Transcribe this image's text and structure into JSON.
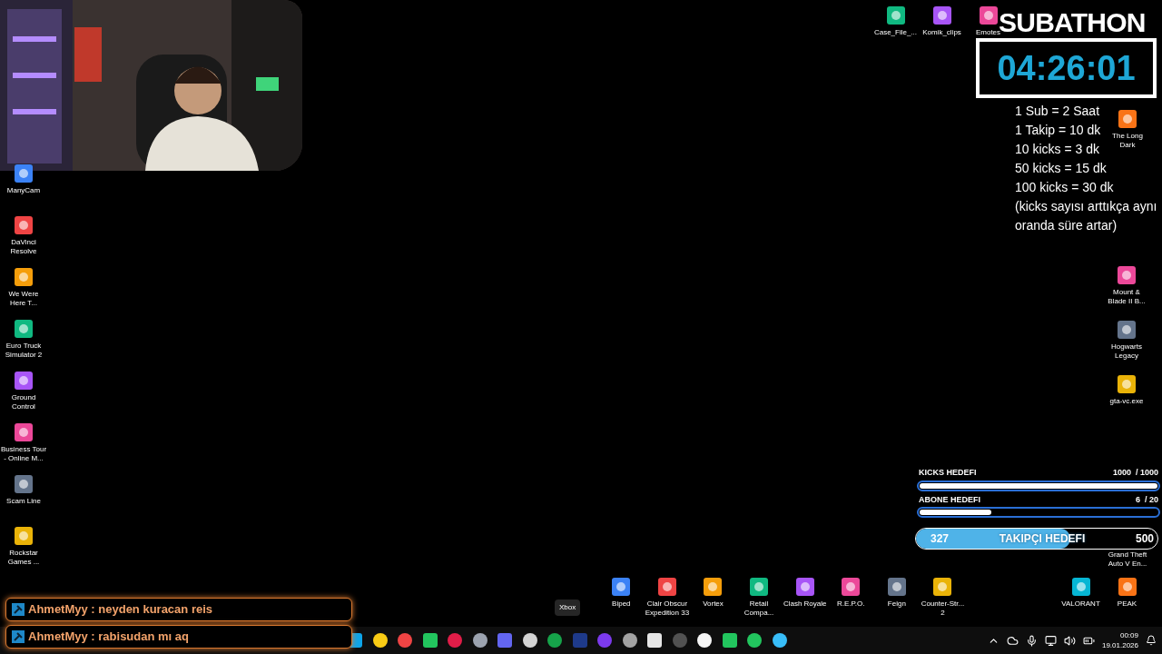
{
  "desktop_left": [
    {
      "label": "ManyCam"
    },
    {
      "label": "DaVinci Resolve"
    },
    {
      "label": "We Were Here T..."
    },
    {
      "label": "Euro Truck Simulator 2"
    },
    {
      "label": "Ground Control"
    },
    {
      "label": "Business Tour - Online M..."
    },
    {
      "label": "Scam Line"
    },
    {
      "label": "Rockstar Games ..."
    }
  ],
  "desktop_top": [
    {
      "label": "Case_File_..."
    },
    {
      "label": "Komik_clips"
    },
    {
      "label": "Emotes"
    }
  ],
  "desktop_right": [
    {
      "label": "The Long Dark"
    },
    {
      "label": "Mount & Blade II B..."
    },
    {
      "label": "Hogwarts Legacy"
    },
    {
      "label": "gta-vc.exe"
    }
  ],
  "desktop_bottom": [
    {
      "label": "Biped"
    },
    {
      "label": "Clair Obscur Expedition 33"
    },
    {
      "label": "Vortex"
    },
    {
      "label": "Retail Compa..."
    },
    {
      "label": "Clash Royale"
    },
    {
      "label": "R.E.P.O."
    },
    {
      "label": "Feign"
    },
    {
      "label": "Counter-Str... 2"
    }
  ],
  "desktop_bottom_right": [
    {
      "label": "VALORANT"
    },
    {
      "label": "PEAK"
    }
  ],
  "subathon": {
    "title": "SUBATHON",
    "timer": "04:26:01",
    "rules": [
      "1 Sub = 2 Saat",
      "1 Takip = 10 dk",
      "10 kicks = 3 dk",
      "50 kicks = 15 dk",
      "100 kicks = 30 dk",
      "(kicks sayısı arttıkça aynı oranda süre artar)"
    ]
  },
  "goals": [
    {
      "label": "KICKS HEDEFI",
      "reading": "1000  / 1000",
      "level": 1
    },
    {
      "label": "ABONE HEDEFI",
      "reading": "6  / 20",
      "level": 0.3
    }
  ],
  "follower_goal": {
    "current": "327",
    "label": "TAKIPÇI HEDEFI",
    "target": "500",
    "level": 0.64
  },
  "gta_icon_label": "Grand Theft Auto V En...",
  "chat": [
    {
      "text": "AhmetMyy : neyden kuracan reis"
    },
    {
      "text": "AhmetMyy : rabisudan mı aq"
    }
  ],
  "tooltip": "Xbox",
  "clock": {
    "time": "00:09",
    "date": "19.01.2026"
  }
}
